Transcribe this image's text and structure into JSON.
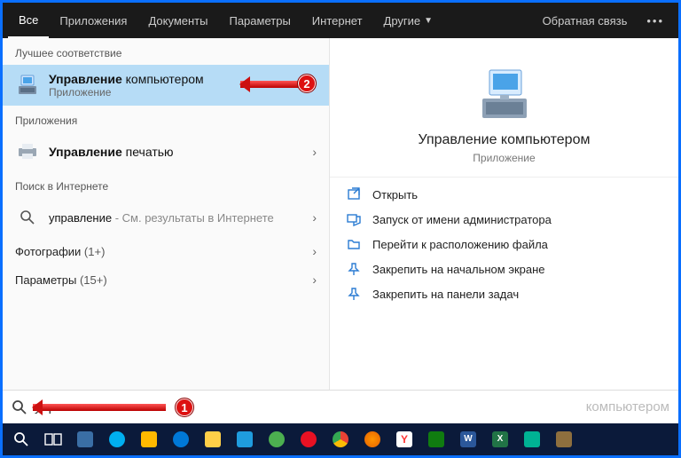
{
  "topbar": {
    "tabs": [
      "Все",
      "Приложения",
      "Документы",
      "Параметры",
      "Интернет",
      "Другие"
    ],
    "feedback": "Обратная связь"
  },
  "left": {
    "best_match": "Лучшее соответствие",
    "best_item": {
      "title_bold": "Управление",
      "title_rest": " компьютером",
      "sub": "Приложение"
    },
    "apps_header": "Приложения",
    "app_item": {
      "title_bold": "Управление",
      "title_rest": " печатью"
    },
    "web_header": "Поиск в Интернете",
    "web_item": {
      "title": "управление",
      "sub": " - См. результаты в Интернете"
    },
    "cat_photos": {
      "label": "Фотографии",
      "count": "(1+)"
    },
    "cat_params": {
      "label": "Параметры",
      "count": "(15+)"
    }
  },
  "right": {
    "title": "Управление компьютером",
    "sub": "Приложение",
    "actions": {
      "open": "Открыть",
      "admin": "Запуск от имени администратора",
      "location": "Перейти к расположению файла",
      "pin_start": "Закрепить на начальном экране",
      "pin_task": "Закрепить на панели задач"
    }
  },
  "search": {
    "value": "управление",
    "placeholder": "компьютером"
  },
  "annotations": {
    "b1": "1",
    "b2": "2"
  }
}
